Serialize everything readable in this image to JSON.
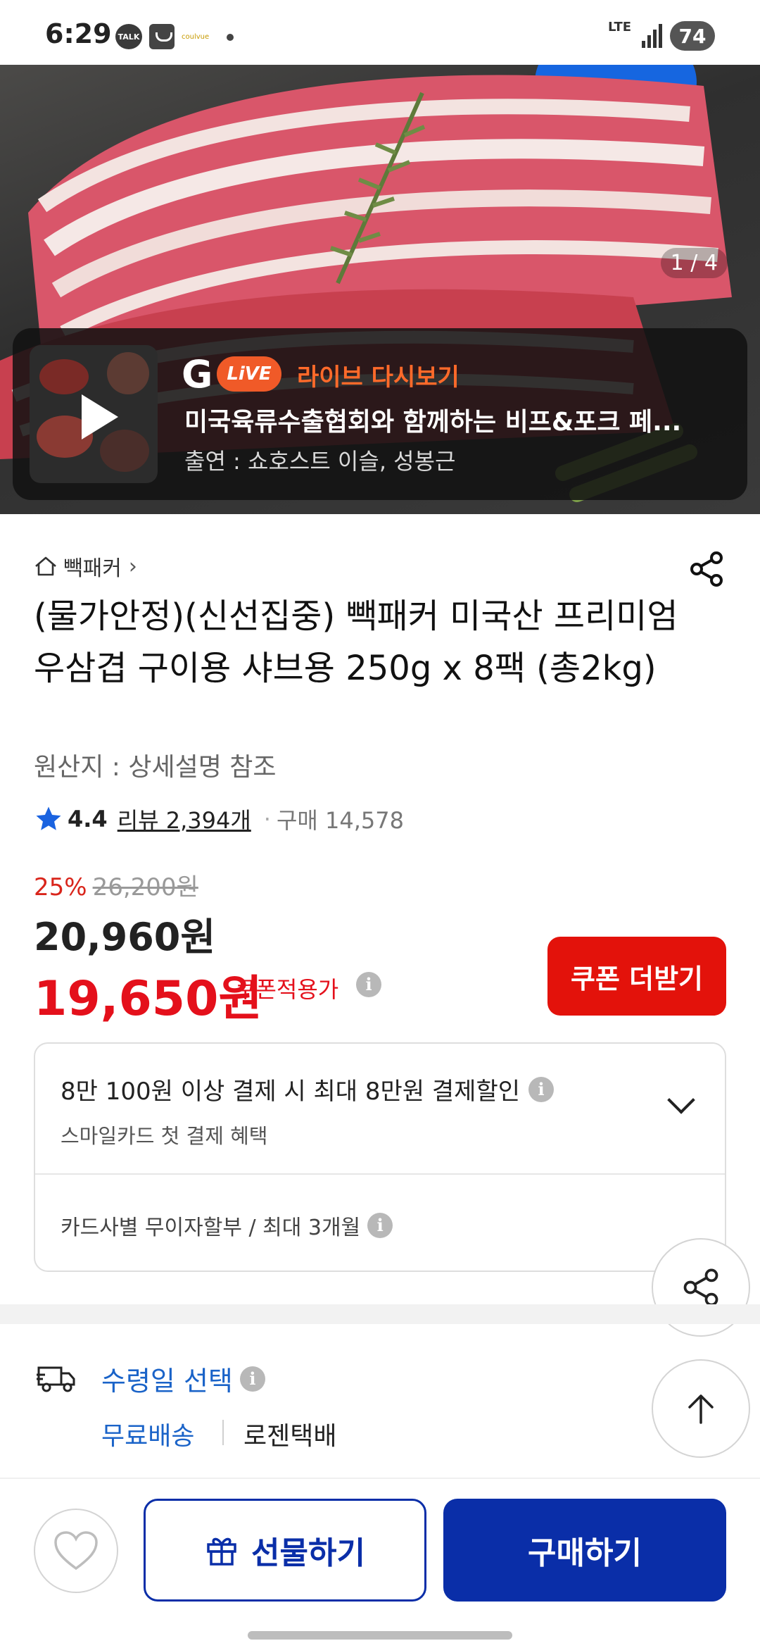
{
  "status_bar": {
    "time": "6:29",
    "network": "LTE",
    "battery": "74",
    "notif_talk": "TALK",
    "notif_brand": "coulvue"
  },
  "hero": {
    "image_counter": "1 / 4",
    "live": {
      "logo_g": "G",
      "logo_live": "LiVE",
      "tag": "라이브 다시보기",
      "title": "미국육류수출협회와 함께하는 비프&포크 페...",
      "cast": "출연 : 쇼호스트 이슬, 성봉근"
    }
  },
  "product": {
    "breadcrumb": "빽패커",
    "title": "(물가안정)(신선집중) 빽패커 미국산 프리미엄 우삼겹 구이용 샤브용 250g x 8팩 (총2kg)",
    "origin": "원산지 : 상세설명 참조",
    "rating": "4.4",
    "review": "리뷰 2,394개",
    "sales": "구매 14,578",
    "discount_rate": "25%",
    "original_price": "26,200원",
    "price": "20,960원",
    "coupon_price": "19,650원",
    "coupon_label": "쿠폰적용가",
    "coupon_button": "쿠폰 더받기"
  },
  "benefits": {
    "main": "8만 100원 이상 결제 시 최대 8만원 결제할인",
    "sub": "스마일카드 첫 결제 혜택",
    "installment": "카드사별 무이자할부 / 최대 3개월"
  },
  "delivery": {
    "select_label": "수령일 선택",
    "free_shipping": "무료배송",
    "courier": "로젠택배"
  },
  "bottom_bar": {
    "gift_label": "선물하기",
    "buy_label": "구매하기"
  },
  "colors": {
    "primary_blue": "#0a2ea8",
    "link_blue": "#1a63c8",
    "sale_red": "#e4101b",
    "live_orange": "#f05a28"
  }
}
